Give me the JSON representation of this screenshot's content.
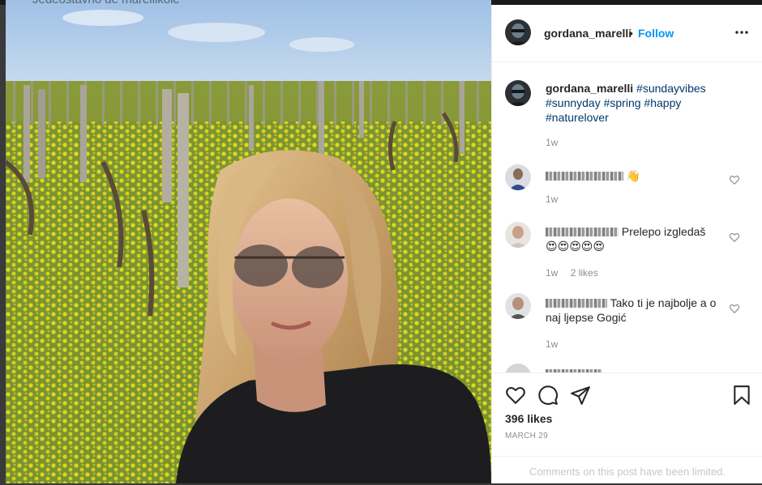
{
  "background_partial_text": "Jedeostavno de marellikoie",
  "photo": {
    "description_icon": "selfie-vineyard-photo"
  },
  "header": {
    "username": "gordana_marelli",
    "separator": "•",
    "follow_label": "Follow",
    "more_icon": "more-options-icon"
  },
  "caption": {
    "username": "gordana_marelli",
    "hashtags": [
      "#sundayvibes",
      "#sunnyday",
      "#spring",
      "#happy",
      "#naturelover"
    ],
    "time": "1w"
  },
  "comments": [
    {
      "user_hidden": true,
      "text": "👋",
      "time": "1w",
      "likes": ""
    },
    {
      "user_hidden": true,
      "text": "Prelepo izgledaš 😍😍😍😍😍",
      "time": "1w",
      "likes": "2 likes"
    },
    {
      "user_hidden": true,
      "text": "Tako ti je najbolje a o naj ljepse Gogić",
      "time": "1w",
      "likes": ""
    }
  ],
  "actions": {
    "like_icon": "heart-icon",
    "comment_icon": "comment-icon",
    "share_icon": "share-icon",
    "save_icon": "bookmark-icon"
  },
  "likes_label": "396 likes",
  "date_label": "MARCH 29",
  "limited_notice": "Comments on this post have been limited.",
  "colors": {
    "link_blue": "#0095f6",
    "hashtag_blue": "#00376b",
    "meta_gray": "#8e8e8e",
    "border": "#efefef"
  }
}
